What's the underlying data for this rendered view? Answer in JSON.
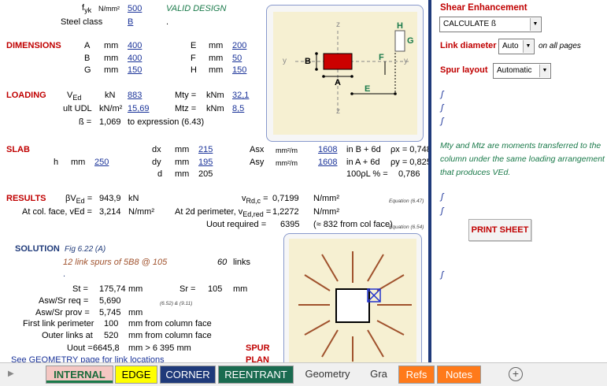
{
  "top": {
    "fyk_label": "f",
    "fyk_sub": "yk",
    "fyk_unit": "N/mm²",
    "fyk_value": "500",
    "valid": "VALID DESIGN",
    "steel_class_label": "Steel class",
    "steel_class_value": "B",
    "dot": "."
  },
  "dimensions": {
    "heading": "DIMENSIONS",
    "rows": [
      {
        "l1": "A",
        "u1": "mm",
        "v1": "400",
        "l2": "E",
        "u2": "mm",
        "v2": "200"
      },
      {
        "l1": "B",
        "u1": "mm",
        "v1": "400",
        "l2": "F",
        "u2": "mm",
        "v2": "50"
      },
      {
        "l1": "G",
        "u1": "mm",
        "v1": "150",
        "l2": "H",
        "u2": "mm",
        "v2": "150"
      }
    ]
  },
  "loading": {
    "heading": "LOADING",
    "ved_label": "V",
    "ved_sub": "Ed",
    "ved_unit": "kN",
    "ved_value": "883",
    "mty_label": "Mty =",
    "mty_unit": "kNm",
    "mty_value": "32,1",
    "udl_label": "ult UDL",
    "udl_unit": "kN/m²",
    "udl_value": "15,69",
    "mtz_label": "Mtz =",
    "mtz_unit": "kNm",
    "mtz_value": "8,5",
    "beta_label": "ß =",
    "beta_value": "1,069",
    "beta_note": "to expression (6.43)"
  },
  "slab": {
    "heading": "SLAB",
    "h_label": "h",
    "h_unit": "mm",
    "h_value": "250",
    "dx_label": "dx",
    "dx_unit": "mm",
    "dx_value": "215",
    "dy_label": "dy",
    "dy_unit": "mm",
    "dy_value": "195",
    "d_label": "d",
    "d_unit": "mm",
    "d_value": "205",
    "asx_label": "Asx",
    "asx_unit": "mm²/m",
    "asx_value": "1608",
    "asx_note": "in B + 6d",
    "asy_label": "Asy",
    "asy_unit": "mm²/m",
    "asy_value": "1608",
    "asy_note": "in A + 6d",
    "px": "ρx = 0,748",
    "py": "ρy = 0,825",
    "pl_label": "100ρL % =",
    "pl_value": "0,786"
  },
  "results": {
    "heading": "RESULTS",
    "bved_label": "βV",
    "bved_sub": "Ed",
    "bved_eq": "=",
    "bved_value": "943,9",
    "bved_unit": "kN",
    "col_label": "At col. face, vEd =",
    "col_value": "3,214",
    "col_unit": "N/mm²",
    "vrd_label": "v",
    "vrd_sub": "Rd,c",
    "vrd_eq": "=",
    "vrd_value": "0,7199",
    "vrd_unit": "N/mm²",
    "vrd_ref": "Equation (6.47)",
    "perim_label": "At 2d perimeter, v",
    "perim_sub": "Ed,red",
    "perim_eq": "=",
    "perim_value": "1,2272",
    "perim_unit": "N/mm²",
    "uout_label": "Uout required =",
    "uout_value": "6395",
    "uout_note": "(≈ 832 from col face)",
    "uout_ref": "Equation (6.54)"
  },
  "solution": {
    "heading": "SOLUTION",
    "fig": "Fig 6.22 (A)",
    "spurs": "12 link spurs of 5B8 @ 105",
    "links_count": "60",
    "links_label": "links",
    "dot": ".",
    "st_label": "St =",
    "st_value": "175,74",
    "st_unit": "mm",
    "sr_label": "Sr =",
    "sr_value": "105",
    "sr_unit": "mm",
    "asw_req_label": "Asw/Sr req =",
    "asw_req_value": "5,690",
    "asw_req_ref": "(6.52) & (9.11)",
    "asw_prov_label": "Asw/Sr prov =",
    "asw_prov_value": "5,745",
    "asw_prov_unit": "mm",
    "first_label": "First link perimeter",
    "first_value": "100",
    "first_note": "mm from column face",
    "outer_label": "Outer links at",
    "outer_value": "520",
    "outer_note": "mm from column face",
    "uout_label": "Uout =",
    "uout_value": "6645,8",
    "uout_note": "mm > 6 395 mm",
    "spur": "SPUR",
    "plan": "PLAN",
    "geometry_note": "See GEOMETRY page for link locations"
  },
  "plan_diagram": {
    "z_top": "z",
    "z_bottom": "z",
    "y_left": "y",
    "y_right": "y",
    "label_a": "A",
    "label_b": "B",
    "label_e": "E",
    "label_f": "F",
    "label_g": "G",
    "label_h": "H"
  },
  "sidebar": {
    "shear_heading": "Shear Enhancement",
    "calc_select": "CALCULATE ß",
    "link_diam_label": "Link diameter",
    "link_diam_select": "Auto",
    "link_diam_note": "on all pages",
    "spur_label": "Spur layout",
    "spur_select": "Automatic",
    "marks": [
      "ʃ",
      "ʃ",
      "ʃ",
      "ʃ",
      "ʃ",
      "ʃ"
    ],
    "note": "Mty and Mtz are moments transferred to the column under the same loading arrangement that produces VEd.",
    "print_button": "PRINT SHEET"
  },
  "tabs": [
    {
      "label": "INTERNAL",
      "bg": "#f4c7c3",
      "fg": "#000000",
      "active": true
    },
    {
      "label": "EDGE",
      "bg": "#ffff00",
      "fg": "#000000"
    },
    {
      "label": "CORNER",
      "bg": "#1f3a7a",
      "fg": "#ffffff"
    },
    {
      "label": "REENTRANT",
      "bg": "#1a6b50",
      "fg": "#ffffff"
    },
    {
      "label": "Geometry",
      "bg": "#f0f0f0",
      "fg": "#333333"
    },
    {
      "label": "Gra",
      "bg": "#f0f0f0",
      "fg": "#333333"
    },
    {
      "label": "Refs",
      "bg": "#ff7a1a",
      "fg": "#ffffff"
    },
    {
      "label": "Notes",
      "bg": "#ff7a1a",
      "fg": "#ffffff"
    }
  ],
  "colors": {
    "accent_red": "#c00000",
    "link_blue": "#1a3399",
    "column_red": "#cc0000",
    "spur_brown": "#a0522d"
  }
}
